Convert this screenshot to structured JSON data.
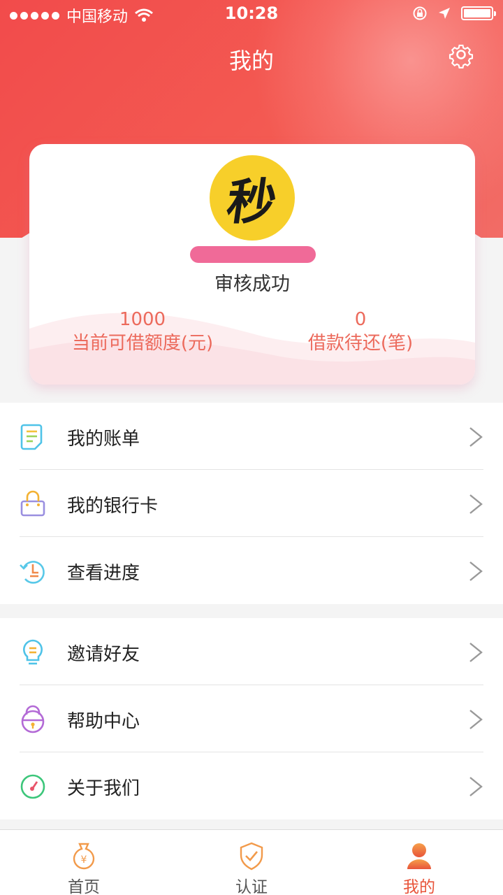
{
  "status_bar": {
    "carrier": "中国移动",
    "time": "10:28",
    "battery_percent": 100
  },
  "header": {
    "title": "我的",
    "settings_icon": "gear-icon"
  },
  "profile": {
    "avatar_text": "秒",
    "phone_masked": "",
    "review_status": "审核成功",
    "stats": [
      {
        "value": "1000",
        "label": "当前可借额度(元)"
      },
      {
        "value": "0",
        "label": "借款待还(笔)"
      }
    ]
  },
  "menu_group_1": [
    {
      "label": "我的账单",
      "icon": "bill-icon"
    },
    {
      "label": "我的银行卡",
      "icon": "bank-card-icon"
    },
    {
      "label": "查看进度",
      "icon": "progress-clock-icon"
    }
  ],
  "menu_group_2": [
    {
      "label": "邀请好友",
      "icon": "lightbulb-icon"
    },
    {
      "label": "帮助中心",
      "icon": "help-lock-icon"
    },
    {
      "label": "关于我们",
      "icon": "about-gauge-icon"
    }
  ],
  "tabbar": [
    {
      "label": "首页",
      "icon": "money-bag-icon",
      "active": false
    },
    {
      "label": "认证",
      "icon": "shield-check-icon",
      "active": false
    },
    {
      "label": "我的",
      "icon": "user-icon",
      "active": true
    }
  ],
  "colors": {
    "header_red": "#f24b4b",
    "stat_text": "#ec6a5c",
    "avatar_yellow": "#f7cf2a",
    "tab_active": "#e8543a"
  }
}
